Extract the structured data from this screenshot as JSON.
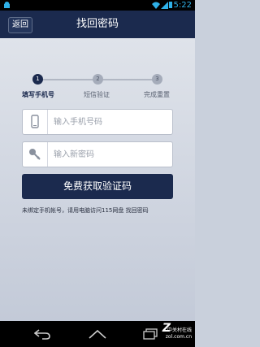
{
  "status_bar": {
    "time": "5:22"
  },
  "header": {
    "back_label": "返回",
    "title": "找回密码"
  },
  "steps": [
    {
      "number": "1",
      "label": "填写手机号",
      "active": true
    },
    {
      "number": "2",
      "label": "短信验证",
      "active": false
    },
    {
      "number": "3",
      "label": "完成重置",
      "active": false
    }
  ],
  "form": {
    "phone_placeholder": "输入手机号码",
    "password_placeholder": "输入新密码",
    "submit_label": "免费获取验证码",
    "tip": "未绑定手机帐号，请用电脑访问115网盘 找回密码"
  },
  "watermark": {
    "line1": "中关村在线",
    "line2": "zol.com.cn"
  },
  "colors": {
    "accent": "#1b2a4e",
    "status_blue": "#2fb1e8",
    "background": "#c9d0dc"
  }
}
